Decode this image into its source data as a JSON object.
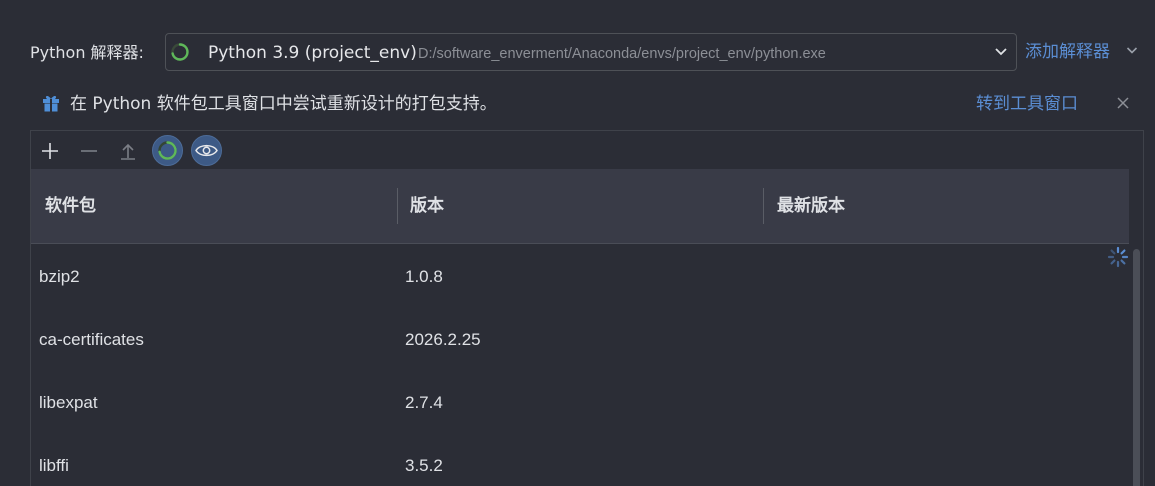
{
  "interpreter": {
    "label": "Python 解释器:",
    "name": "Python 3.9 (project_env)",
    "path": "D:/software_enverment/Anaconda/envs/project_env/python.exe",
    "add_label": "添加解释器"
  },
  "banner": {
    "text": "在 Python 软件包工具窗口中尝试重新设计的打包支持。",
    "link": "转到工具窗口"
  },
  "table": {
    "columns": [
      "软件包",
      "版本",
      "最新版本"
    ],
    "rows": [
      {
        "name": "bzip2",
        "version": "1.0.8",
        "latest": ""
      },
      {
        "name": "ca-certificates",
        "version": "2026.2.25",
        "latest": ""
      },
      {
        "name": "libexpat",
        "version": "2.7.4",
        "latest": ""
      },
      {
        "name": "libffi",
        "version": "3.5.2",
        "latest": ""
      }
    ]
  },
  "colors": {
    "background": "#2b2d36",
    "accent_link": "#5b8ed4",
    "header_bg": "#393b47",
    "spinner_green": "#5fb85a",
    "banner_icon": "#4f8fd8"
  }
}
